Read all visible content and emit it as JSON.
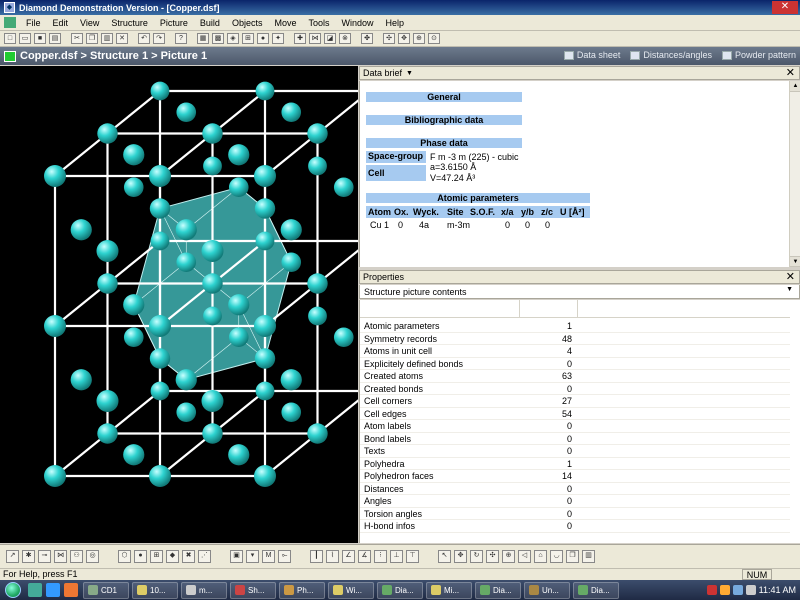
{
  "window": {
    "title": "Diamond Demonstration Version - [Copper.dsf]",
    "close_glyph": "✕"
  },
  "menu": [
    "File",
    "Edit",
    "View",
    "Structure",
    "Picture",
    "Build",
    "Objects",
    "Move",
    "Tools",
    "Window",
    "Help"
  ],
  "breadcrumb": "Copper.dsf > Structure 1 > Picture 1",
  "view_tabs": [
    "Data sheet",
    "Distances/angles",
    "Powder pattern"
  ],
  "data_brief": {
    "header": "Data brief",
    "general": "General",
    "bibliographic": "Bibliographic data",
    "phase": "Phase data",
    "space_group_label": "Space-group",
    "space_group_value": "F m -3 m (225) - cubic",
    "cell_label": "Cell",
    "cell_a": "a=3.6150 Å",
    "cell_v": "V=47.24 Å³",
    "atomic_parameters": "Atomic parameters",
    "atom_headers": [
      "Atom",
      "Ox.",
      "Wyck.",
      "Site",
      "S.O.F.",
      "x/a",
      "y/b",
      "z/c",
      "U [Å²]"
    ],
    "atom_row": [
      "Cu 1",
      "0",
      "4a",
      "m-3m",
      "",
      "0",
      "0",
      "0",
      ""
    ]
  },
  "properties": {
    "header": "Properties",
    "selector": "Structure picture contents",
    "rows": [
      {
        "name": "Atomic parameters",
        "value": "1"
      },
      {
        "name": "Symmetry records",
        "value": "48"
      },
      {
        "name": "Atoms in unit cell",
        "value": "4"
      },
      {
        "name": "Explicitely defined bonds",
        "value": "0"
      },
      {
        "name": "Created atoms",
        "value": "63"
      },
      {
        "name": "Created bonds",
        "value": "0"
      },
      {
        "name": "Cell corners",
        "value": "27"
      },
      {
        "name": "Cell edges",
        "value": "54"
      },
      {
        "name": "Atom labels",
        "value": "0"
      },
      {
        "name": "Bond labels",
        "value": "0"
      },
      {
        "name": "Texts",
        "value": "0"
      },
      {
        "name": "Polyhedra",
        "value": "1"
      },
      {
        "name": "Polyhedron faces",
        "value": "14"
      },
      {
        "name": "Distances",
        "value": "0"
      },
      {
        "name": "Angles",
        "value": "0"
      },
      {
        "name": "Torsion angles",
        "value": "0"
      },
      {
        "name": "H-bond infos",
        "value": "0"
      }
    ]
  },
  "status": {
    "help": "For Help, press F1",
    "num": "NUM"
  },
  "taskbar": {
    "tasks": [
      {
        "label": "CD1",
        "color": "#8a8"
      },
      {
        "label": "10...",
        "color": "#dc6"
      },
      {
        "label": "m...",
        "color": "#ccc"
      },
      {
        "label": "Sh...",
        "color": "#c44"
      },
      {
        "label": "Ph...",
        "color": "#c94"
      },
      {
        "label": "Wi...",
        "color": "#dc6"
      },
      {
        "label": "Dia...",
        "color": "#6a6"
      },
      {
        "label": "Mi...",
        "color": "#dc6"
      },
      {
        "label": "Dia...",
        "color": "#6a6"
      },
      {
        "label": "Un...",
        "color": "#a84"
      },
      {
        "label": "Dia...",
        "color": "#6a6"
      }
    ],
    "clock": "11:41 AM"
  },
  "colors": {
    "atom": "#2ed3d0",
    "polyhedron": "#3fb3b3",
    "section_header": "#a6caf0"
  }
}
